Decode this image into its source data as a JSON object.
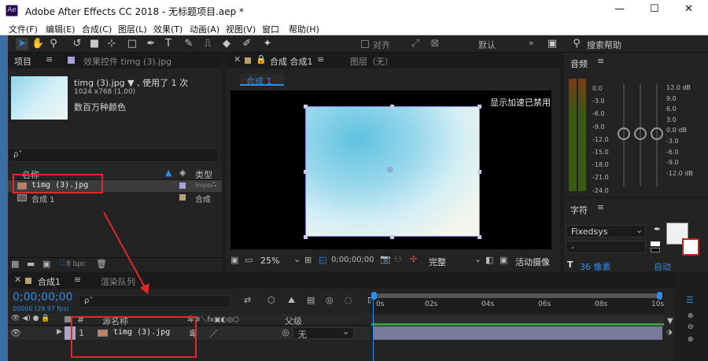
{
  "window": {
    "title": "Adobe After Effects CC 2018 - 无标题项目.aep *",
    "app_icon": "Ae",
    "min": "—",
    "max": "☐",
    "close": "✕"
  },
  "menu": [
    "文件(F)",
    "编辑(E)",
    "合成(C)",
    "图层(L)",
    "效果(T)",
    "动画(A)",
    "视图(V)",
    "窗口",
    "帮助(H)"
  ],
  "toolbar": {
    "align_label": "对齐",
    "workspace": "默认",
    "search_placeholder": "搜索帮助"
  },
  "project": {
    "tab_project": "项目",
    "tab_effects": "效果控件 timg (3).jpg",
    "preview_name": "timg (3).jpg ▼ , 使用了 1 次",
    "preview_dims": "1024 x768 (1.00)",
    "preview_colors": "数百万种颜色",
    "search_placeholder": "ρ˅",
    "col_name": "名称",
    "col_type": "类型",
    "items": [
      {
        "name": "timg (3).jpg",
        "type": "Impo"
      },
      {
        "name": "合成 1",
        "type": "合成"
      }
    ],
    "bpc": "8 bpc"
  },
  "comp": {
    "tab_comp": "合成 合成1",
    "tab_layer": "图层（无）",
    "sub_tab": "合成 1",
    "notice": "显示加速已禁用",
    "zoom": "25%",
    "timecode": "0;00;00;00",
    "quality": "完整",
    "camera": "活动摄像"
  },
  "audio": {
    "tab": "音频",
    "left_scale": [
      "0.0",
      "-3.0",
      "-6.0",
      "-9.0",
      "-12.0",
      "-15.0",
      "-18.0",
      "-21.0",
      "-24.0"
    ],
    "right_scale": [
      "12.0 dB",
      "12.0",
      "9.0",
      "6.0",
      "3.0",
      "0.0 dB",
      "-3.0",
      "-6.0",
      "-9.0",
      "-12.0 dB"
    ]
  },
  "character": {
    "tab": "字符",
    "font": "Fixedsys",
    "style": "-",
    "size": "36 像素",
    "kerning": "自动"
  },
  "timeline": {
    "tab_comp": "合成1",
    "tab_render": "渲染队列",
    "timecode": "0;00;00;00",
    "fps": "00000 (29.97 fps)",
    "search_placeholder": "ρ˅",
    "col_num": "#",
    "col_source": "源名称",
    "col_parent": "父级",
    "layer": {
      "num": "1",
      "name": "timg (3).jpg",
      "parent": "无"
    },
    "ruler": [
      "0s",
      "02s",
      "04s",
      "06s",
      "08s",
      "10s"
    ]
  },
  "colors": {
    "accent": "#2d8ceb",
    "annotation": "#e0282a",
    "layer_bar": "#7a7a9c",
    "layer_label": "#a9a5c7"
  }
}
